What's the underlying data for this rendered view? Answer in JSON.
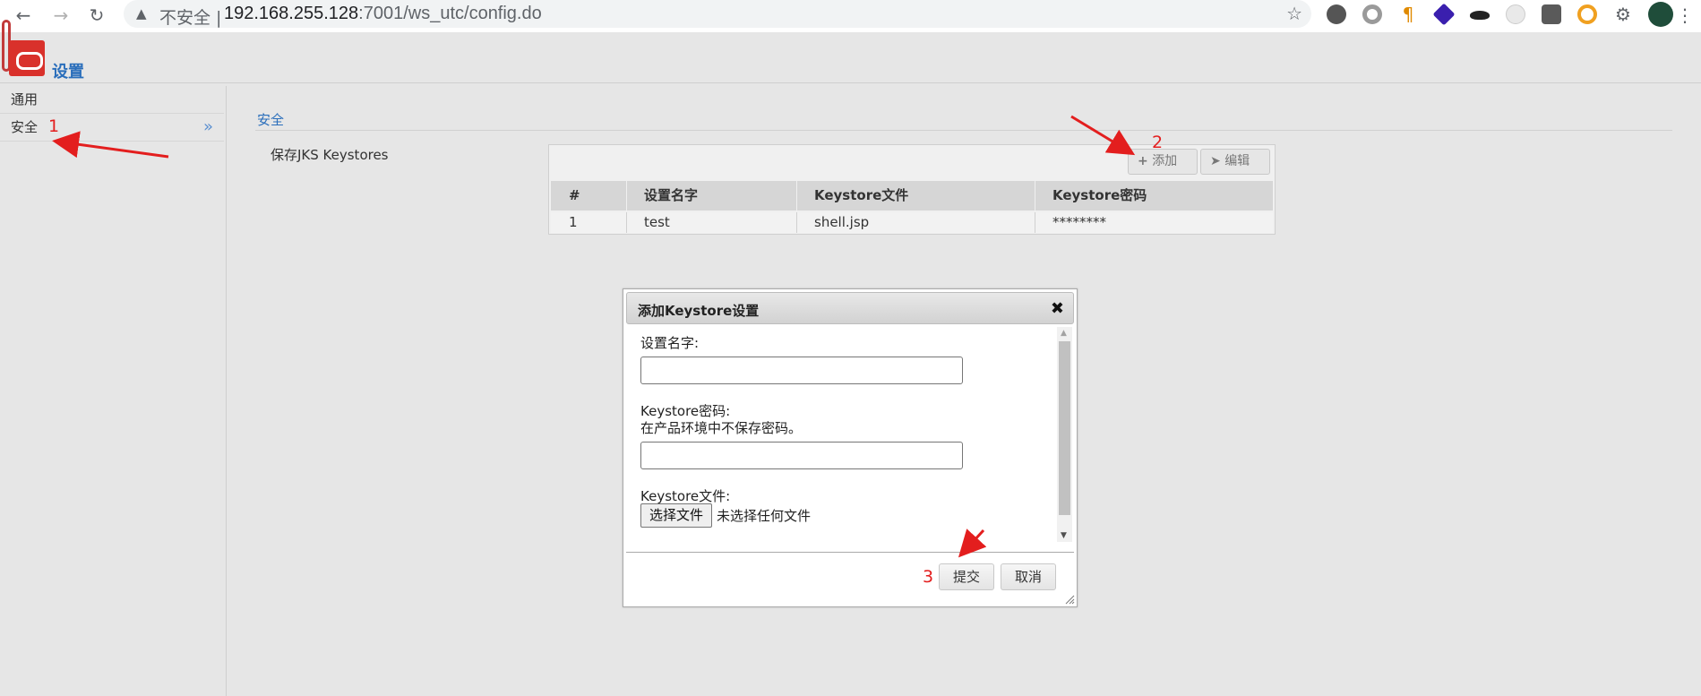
{
  "browser": {
    "security_label": "不安全",
    "url_host": "192.168.255.128",
    "url_path": ":7001/ws_utc/config.do"
  },
  "app": {
    "title": "设置"
  },
  "sidebar": {
    "items": [
      {
        "label": "通用"
      },
      {
        "label": "安全"
      }
    ],
    "expand_glyph": "»"
  },
  "main": {
    "section_title": "安全",
    "field_label": "保存JKS Keystores",
    "toolbar": {
      "add_label": "添加",
      "edit_label": "编辑"
    },
    "table": {
      "columns": [
        "#",
        "设置名字",
        "Keystore文件",
        "Keystore密码"
      ],
      "rows": [
        [
          "1",
          "test",
          "shell.jsp",
          "********"
        ]
      ]
    }
  },
  "dialog": {
    "title": "添加Keystore设置",
    "name_label": "设置名字:",
    "password_label": "Keystore密码:",
    "password_hint": "在产品环境中不保存密码。",
    "file_label": "Keystore文件:",
    "file_button": "选择文件",
    "file_none": "未选择任何文件",
    "submit_label": "提交",
    "cancel_label": "取消"
  },
  "annotations": [
    "1",
    "2",
    "3"
  ],
  "colors": {
    "accent_blue": "#2a6ebb",
    "annotation_red": "#e31e1e",
    "logo_red": "#d9312b"
  }
}
